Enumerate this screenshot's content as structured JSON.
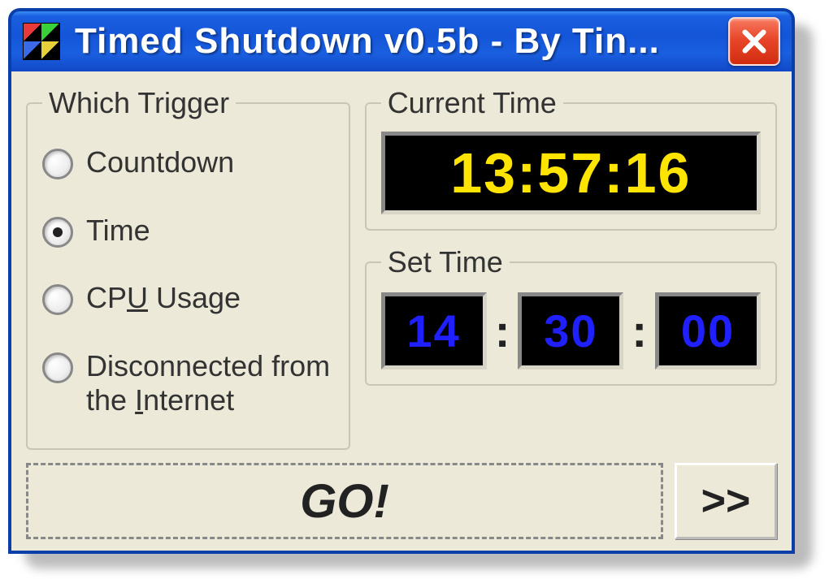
{
  "window": {
    "title": "Timed Shutdown v0.5b - By Tin..."
  },
  "trigger": {
    "legend": "Which Trigger",
    "options": {
      "countdown": "Countdown",
      "time": "Time",
      "cpu_prefix": "CP",
      "cpu_accel": "U",
      "cpu_suffix": " Usage",
      "net_prefix": "Disconnected from the ",
      "net_accel": "I",
      "net_suffix": "nternet"
    },
    "selected": "time"
  },
  "current_time": {
    "legend": "Current Time",
    "value": "13:57:16"
  },
  "set_time": {
    "legend": "Set Time",
    "hh": "14",
    "mm": "30",
    "ss": "00"
  },
  "footer": {
    "go": "GO!",
    "more": ">>"
  }
}
